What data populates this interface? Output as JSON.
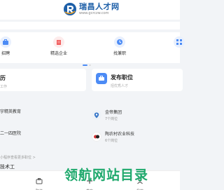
{
  "header": {
    "logo_name": "瑞昌人才网",
    "logo_url": "www.gcrczw.com"
  },
  "categories": [
    {
      "label": "招聘",
      "icon": "briefcase-icon"
    },
    {
      "label": "精选企业",
      "icon": "building-icon"
    },
    {
      "label": "找兼职",
      "icon": "clock-icon"
    }
  ],
  "cards": {
    "resume": {
      "title": "历",
      "sub": "工作"
    },
    "post_job": {
      "title": "发布职位",
      "sub": "招优秀人才"
    }
  },
  "companies": [
    {
      "name": "宇精英教育",
      "jobs": ""
    },
    {
      "name": "金帝集团",
      "jobs": "7个岗位"
    },
    {
      "name": "二一四医院",
      "jobs": ""
    },
    {
      "name": "陶农村农业科技",
      "jobs": "6个岗位"
    }
  ],
  "more_text": "小程序查看更多职位 >",
  "partial_text": "技术工",
  "tabbar": [
    {
      "label": "职位",
      "icon": "briefcase-icon"
    },
    {
      "label": "发布",
      "icon": "plus-icon"
    },
    {
      "label": "我的",
      "icon": "user-icon"
    }
  ],
  "watermark": "领航网站目录",
  "colors": {
    "brand": "#1d5fa8",
    "accent": "#4c8bf5",
    "watermark": "#1fa96d"
  }
}
